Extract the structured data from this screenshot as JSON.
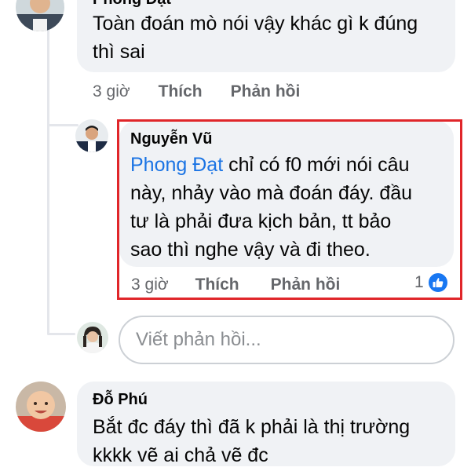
{
  "comment_1": {
    "author": "Phong Đạt",
    "text_line1": "Toàn đoán mò nói vậy khác gì k đúng",
    "text_line2": "thì sai",
    "time": "3 giờ",
    "like_label": "Thích",
    "reply_label": "Phản hồi"
  },
  "reply_1": {
    "author": "Nguyễn Vũ",
    "mention": "Phong Đạt",
    "text_line1_rest": " chỉ có f0 mới nói câu",
    "text_line2": "này, nhảy vào mà đoán đáy. đầu",
    "text_line3": "tư là phải đưa kịch bản, tt bảo",
    "text_line4": "sao thì nghe vậy và đi theo.",
    "time": "3 giờ",
    "like_label": "Thích",
    "reply_label": "Phản hồi",
    "reaction_count": "1",
    "reaction_icon": "thumbs-up-icon",
    "highlight_color": "#e0262a"
  },
  "reply_input": {
    "placeholder": "Viết phản hồi..."
  },
  "comment_2": {
    "author": "Đỗ Phú",
    "text_line1": "Bắt đc đáy thì đã k phải là thị trường",
    "text_line2": "kkkk vẽ ai chả vẽ đc"
  },
  "colors": {
    "bubble": "#f0f2f5",
    "mention": "#1b74e4",
    "meta": "#65676b",
    "like_blue": "#1877f2"
  }
}
